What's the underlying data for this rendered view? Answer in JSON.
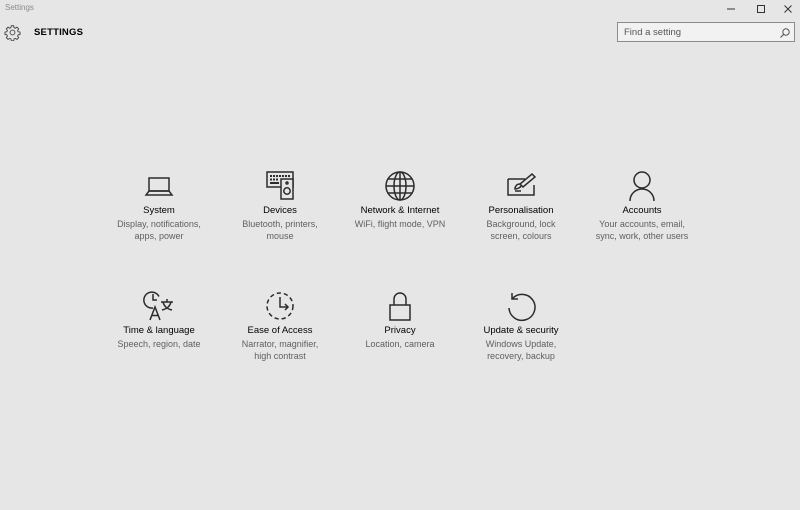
{
  "window": {
    "title": "Settings",
    "controls": [
      "minimize-icon",
      "maximize-icon",
      "close-icon"
    ]
  },
  "header": {
    "title": "SETTINGS",
    "icon": "gear-icon"
  },
  "search": {
    "placeholder": "Find a setting",
    "value": "",
    "icon": "search-icon"
  },
  "categories": [
    {
      "label": "System",
      "desc1": "Display, notifications,",
      "desc2": "apps, power",
      "icon": "laptop-icon"
    },
    {
      "label": "Devices",
      "desc1": "Bluetooth, printers,",
      "desc2": "mouse",
      "icon": "devices-icon"
    },
    {
      "label": "Network & Internet",
      "desc1": "WiFi, flight mode, VPN",
      "desc2": "",
      "icon": "globe-icon"
    },
    {
      "label": "Personalisation",
      "desc1": "Background, lock",
      "desc2": "screen, colours",
      "icon": "paintbrush-icon"
    },
    {
      "label": "Accounts",
      "desc1": "Your accounts, email,",
      "desc2": "sync, work, other users",
      "icon": "person-icon"
    },
    {
      "label": "Time & language",
      "desc1": "Speech, region, date",
      "desc2": "",
      "icon": "clock-language-icon"
    },
    {
      "label": "Ease of Access",
      "desc1": "Narrator, magnifier,",
      "desc2": "high contrast",
      "icon": "ease-of-access-icon"
    },
    {
      "label": "Privacy",
      "desc1": "Location, camera",
      "desc2": "",
      "icon": "lock-icon"
    },
    {
      "label": "Update & security",
      "desc1": "Windows Update,",
      "desc2": "recovery, backup",
      "icon": "refresh-icon"
    }
  ],
  "colors": {
    "background": "#e6e6e6",
    "icon_stroke": "#2b2b2b",
    "description_text": "#606060"
  }
}
